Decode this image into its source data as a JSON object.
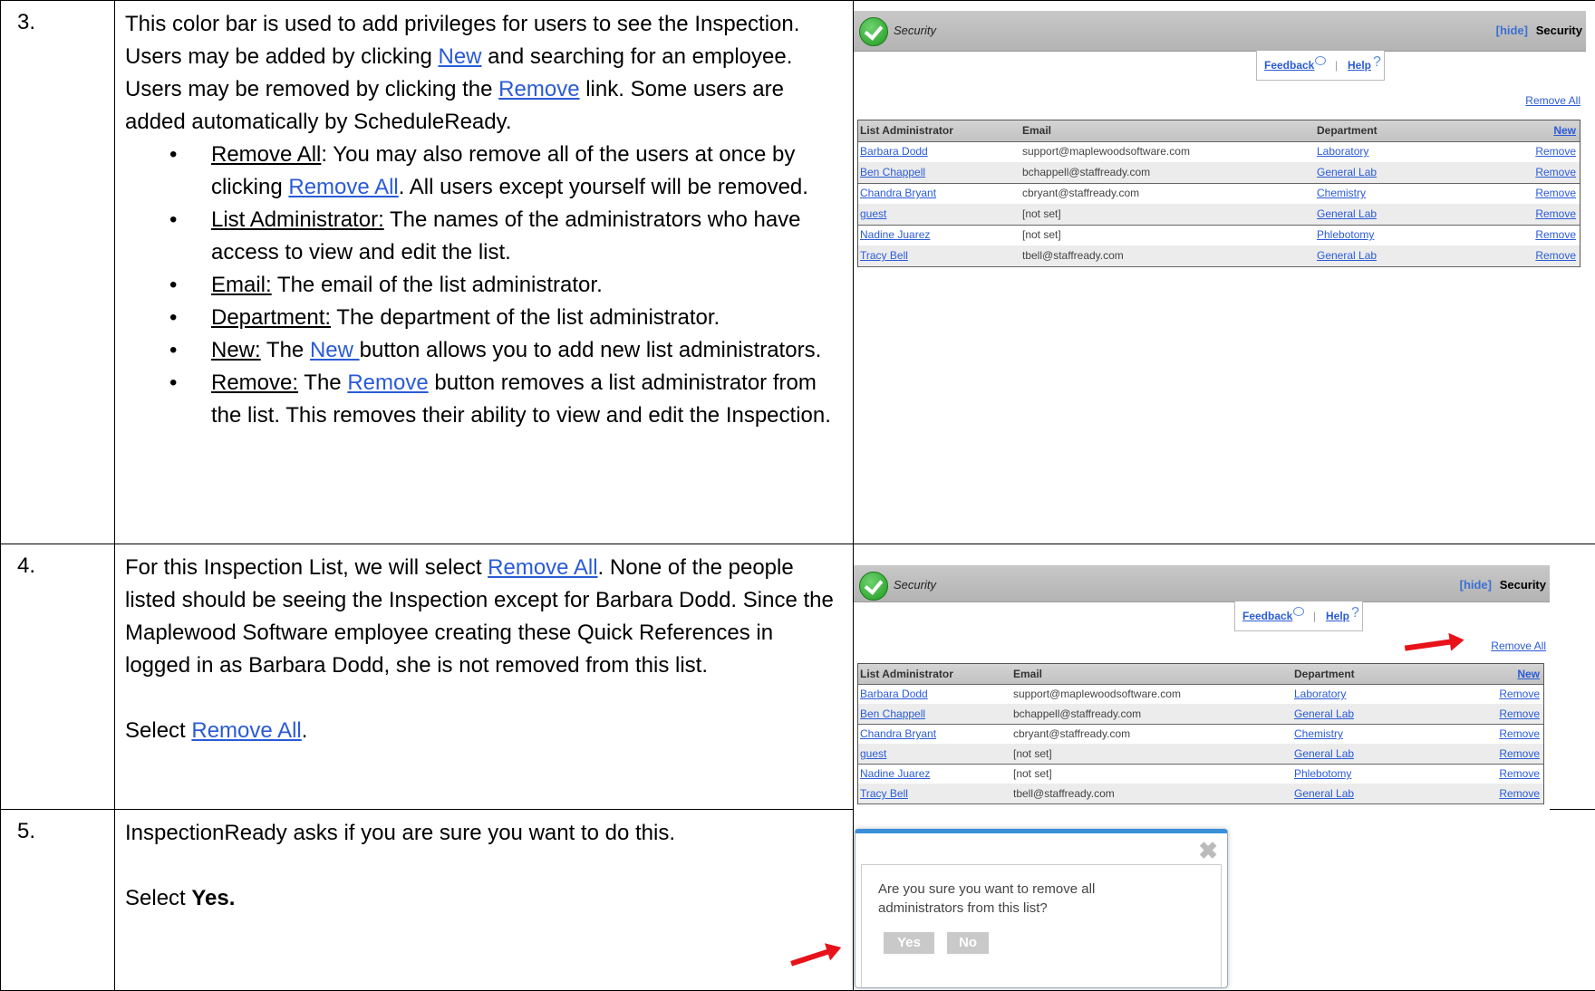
{
  "rows": [
    {
      "num": "3.",
      "intro": [
        {
          "t": "This color bar is used to add privileges for users to see the Inspection. Users may be added by clicking "
        },
        {
          "t": "New",
          "link": true
        },
        {
          "t": " and searching for an employee. Users may be removed by clicking the "
        },
        {
          "t": "Remove",
          "link": true
        },
        {
          "t": " link. Some users are added automatically by ScheduleReady."
        }
      ],
      "bullets": [
        {
          "term": "Remove All",
          "parts": [
            {
              "t": ": You may also remove all of the users at once by clicking "
            },
            {
              "t": "Remove All",
              "link": true
            },
            {
              "t": ". All users except yourself will be removed."
            }
          ]
        },
        {
          "term": "List Administrator:",
          "parts": [
            {
              "t": " The names of the administrators who have access to view and edit the list."
            }
          ]
        },
        {
          "term": "Email:",
          "parts": [
            {
              "t": " The email of the list administrator."
            }
          ]
        },
        {
          "term": "Department:",
          "parts": [
            {
              "t": " The department of the list administrator."
            }
          ]
        },
        {
          "term": "New:",
          "parts": [
            {
              "t": " The "
            },
            {
              "t": "New ",
              "link": true
            },
            {
              "t": "button allows you to add new list administrators."
            }
          ]
        },
        {
          "term": "Remove:",
          "parts": [
            {
              "t": " The "
            },
            {
              "t": "Remove",
              "link": true
            },
            {
              "t": " button removes a list administrator from the list. This removes their ability to view and edit the Inspection."
            }
          ]
        }
      ]
    },
    {
      "num": "4.",
      "para1": [
        {
          "t": "For this Inspection List, we will select "
        },
        {
          "t": "Remove All",
          "link": true
        },
        {
          "t": ". None of the people listed should be seeing the Inspection except for Barbara Dodd.  Since the Maplewood Software employee creating these Quick References in logged in as Barbara Dodd, she is not removed from this list."
        }
      ],
      "para2": [
        {
          "t": "Select "
        },
        {
          "t": "Remove All",
          "link": true
        },
        {
          "t": "."
        }
      ]
    },
    {
      "num": "5.",
      "para1": "InspectionReady asks if you are sure you want to do this.",
      "select_prefix": "Select ",
      "select_bold": "Yes."
    }
  ],
  "security_panel": {
    "title": "Security",
    "hide": "[hide]",
    "right_title": "Security",
    "feedback": "Feedback",
    "sep": "|",
    "help": "Help",
    "help_q": "?",
    "remove_all": "Remove All",
    "columns": {
      "admin": "List Administrator",
      "email": "Email",
      "dept": "Department",
      "new": "New"
    },
    "remove_label": "Remove",
    "admins": [
      {
        "name": "Barbara Dodd",
        "email": "support@maplewoodsoftware.com",
        "dept": "Laboratory"
      },
      {
        "name": "Ben Chappell",
        "email": "bchappell@staffready.com",
        "dept": "General Lab"
      },
      {
        "name": "Chandra Bryant",
        "email": "cbryant@staffready.com",
        "dept": "Chemistry"
      },
      {
        "name": "guest",
        "email": "[not set]",
        "dept": "General Lab"
      },
      {
        "name": "Nadine Juarez",
        "email": "[not set]",
        "dept": "Phlebotomy"
      },
      {
        "name": "Tracy Bell",
        "email": "tbell@staffready.com",
        "dept": "General Lab"
      }
    ]
  },
  "dialog": {
    "close": "✖",
    "message": "Are you sure you want to remove all administrators from this list?",
    "yes": "Yes",
    "no": "No"
  },
  "colors": {
    "link": "#2a5bd7",
    "arrow": "#e8121a",
    "bar": "#b3b3b3",
    "dialog_top": "#3a8fd8"
  }
}
